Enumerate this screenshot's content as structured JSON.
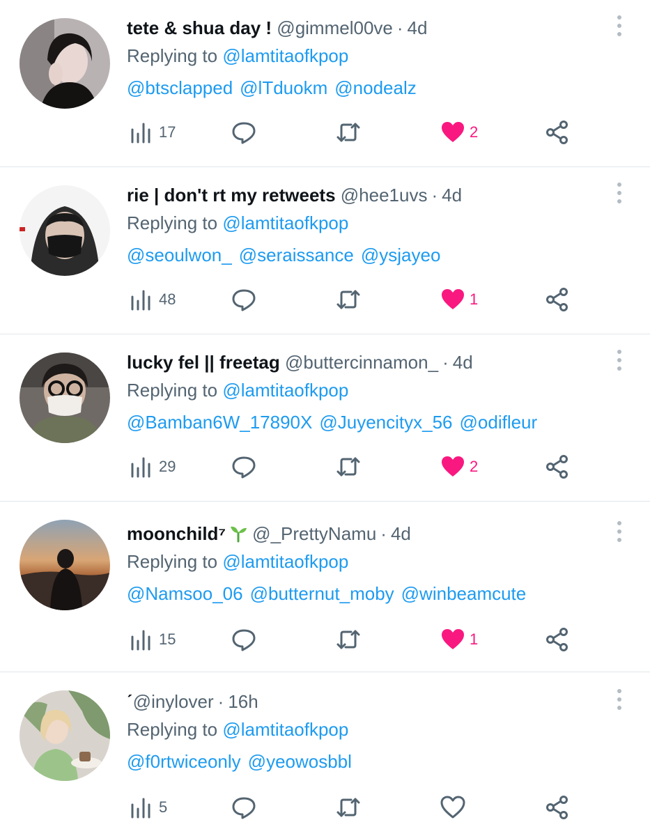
{
  "colors": {
    "link": "#1d9bf0",
    "muted": "#536471",
    "like": "#f91880",
    "divider": "#e1e6ea"
  },
  "icons": {
    "views": "analytics-bar-icon",
    "reply": "speech-bubble-icon",
    "retweet": "retweet-arrows-icon",
    "like_filled": "heart-filled-icon",
    "like_outline": "heart-outline-icon",
    "share": "share-nodes-icon",
    "more": "more-vertical-icon"
  },
  "reply_prefix": "Replying to",
  "tweets": [
    {
      "name": "tete & shua day !",
      "handle": "@gimmel00ve",
      "time": "4d",
      "replying_to": "@lamtitaofkpop",
      "mentions": [
        "@btsclapped",
        "@lTduokm",
        "@nodealz"
      ],
      "views": "17",
      "likes": "2",
      "liked": true
    },
    {
      "name": "rie | don't rt my retweets",
      "handle": "@hee1uvs",
      "time": "4d",
      "replying_to": "@lamtitaofkpop",
      "mentions": [
        "@seoulwon_",
        "@seraissance",
        "@ysjayeo"
      ],
      "views": "48",
      "likes": "1",
      "liked": true
    },
    {
      "name": "lucky fel || freetag",
      "handle": "@buttercinnamon_",
      "time": "4d",
      "replying_to": "@lamtitaofkpop",
      "mentions": [
        "@Bamban6W_17890X",
        "@Juyencityx_56",
        "@odifleur"
      ],
      "views": "29",
      "likes": "2",
      "liked": true
    },
    {
      "name": "moonchild⁷",
      "handle": "@_PrettyNamu",
      "time": "4d",
      "replying_to": "@lamtitaofkpop",
      "mentions": [
        "@Namsoo_06",
        "@butternut_moby",
        "@winbeamcute"
      ],
      "views": "15",
      "likes": "1",
      "liked": true,
      "emoji": "seedling-icon"
    },
    {
      "name": "ˊ",
      "handle": "@inylover",
      "time": "16h",
      "replying_to": "@lamtitaofkpop",
      "mentions": [
        "@f0rtwiceonly",
        "@yeowosbbl"
      ],
      "views": "5",
      "likes": "",
      "liked": false
    }
  ]
}
